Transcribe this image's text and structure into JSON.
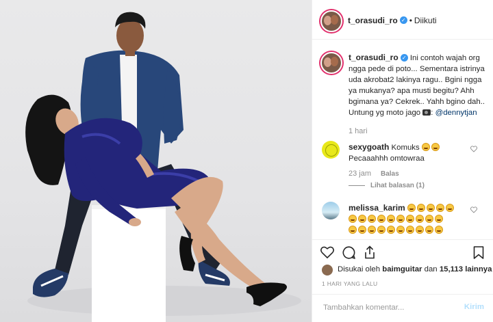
{
  "header": {
    "username": "t_orasudi_ro",
    "separator": "•",
    "follow_status": "Diikuti"
  },
  "caption": {
    "username": "t_orasudi_ro",
    "text": "Ini contoh wajah org ngga pede di poto... Sementara istrinya uda akrobat2 lakinya ragu.. Bgini ngga ya mukanya? apa musti begitu? Ahh bgimana ya? Cekrek.. Yahh bgino dah..",
    "credit_prefix": "Untung yg moto jago",
    "credit_icon": "camera-emoji",
    "credit_handle": "@dennytjan",
    "time": "1 hari"
  },
  "comments": [
    {
      "username": "sexygoath",
      "text_before": "Komuks",
      "text_after": "Pecaaahhh omtowraa",
      "emojis": [
        "laughing-emoji",
        "laughing-emoji"
      ],
      "time": "23 jam",
      "reply_label": "Balas",
      "view_replies": "Lihat balasan (1)"
    },
    {
      "username": "melissa_karim",
      "emojis": [
        "rofl-emoji"
      ]
    }
  ],
  "likes": {
    "prefix": "Disukai oleh",
    "user": "baimguitar",
    "middle": "dan",
    "count": "15,113 lainnya"
  },
  "post_date": "1 HARI YANG LALU",
  "composer": {
    "placeholder": "Tambahkan komentar...",
    "post_label": "Kirim"
  },
  "colors": {
    "link": "#003569",
    "verified": "#3897f0",
    "muted": "#8e8e8e",
    "post_disabled": "#b2dffc",
    "story_ring": "#e1306c"
  }
}
